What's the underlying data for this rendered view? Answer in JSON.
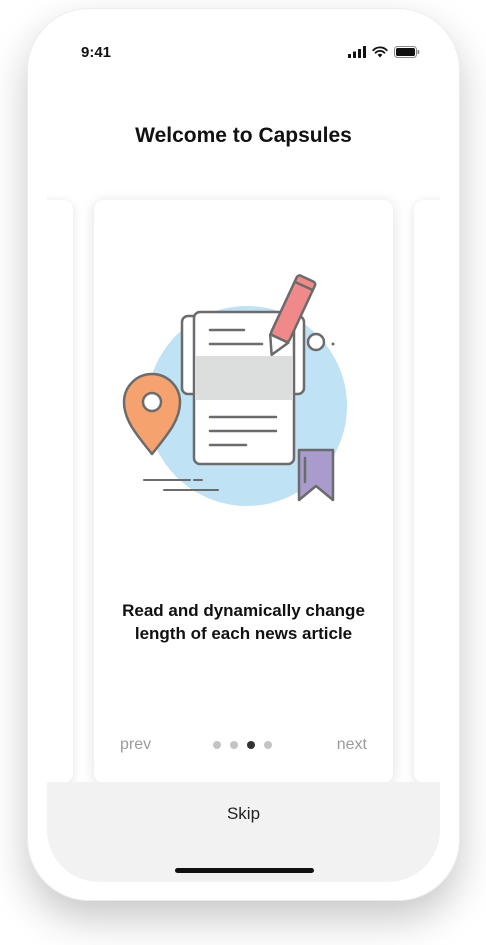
{
  "status_bar": {
    "time": "9:41",
    "icons": [
      "signal-icon",
      "wifi-icon",
      "battery-icon"
    ]
  },
  "header": {
    "title": "Welcome to Capsules"
  },
  "card": {
    "illustration": "news-article-illustration",
    "text": "Read and dynamically change length of each news article",
    "colors": {
      "circle": "#bfe2f4",
      "pencil": "#f08a8a",
      "pin": "#f6a26f",
      "bookmark": "#a99ccd",
      "outline": "#6b6b6b"
    }
  },
  "pager": {
    "prev_label": "prev",
    "next_label": "next",
    "total": 4,
    "active_index": 2
  },
  "footer": {
    "skip_label": "Skip"
  }
}
